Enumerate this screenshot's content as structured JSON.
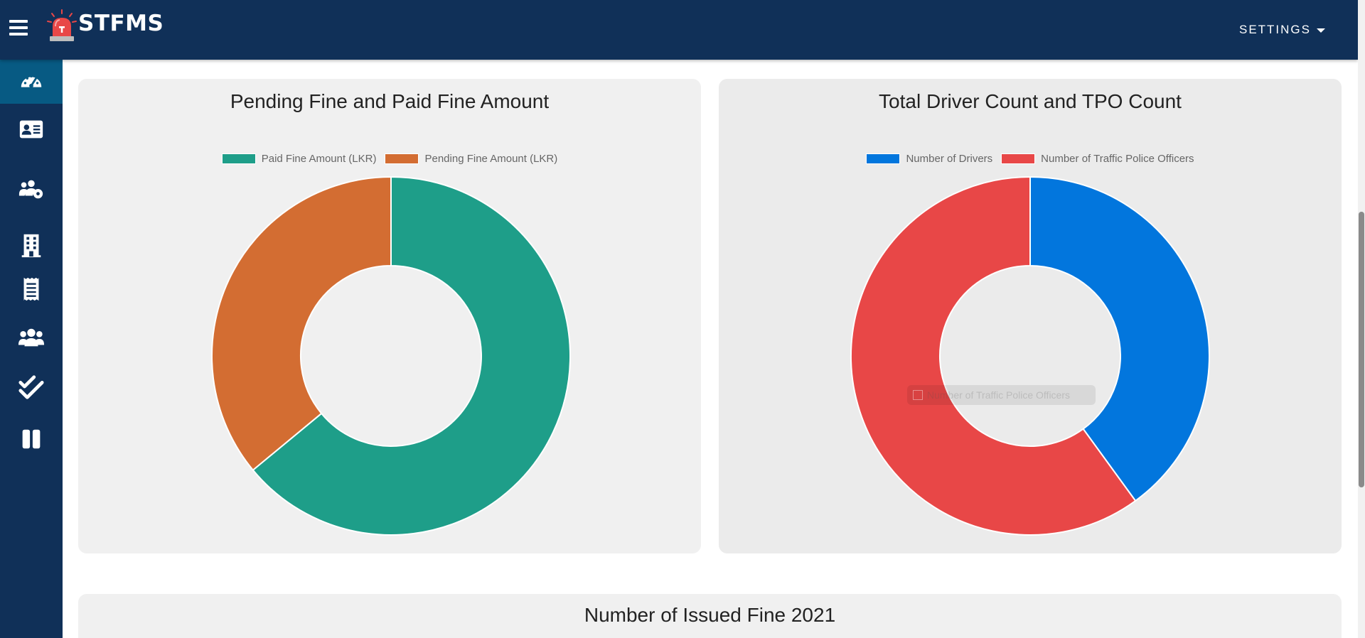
{
  "app": {
    "name": "STFMS"
  },
  "header": {
    "settings_label": "SETTINGS"
  },
  "sidebar": {
    "items": [
      {
        "icon": "dashboard-icon",
        "active": true
      },
      {
        "icon": "id-card-icon",
        "active": false
      },
      {
        "icon": "users-cog-icon",
        "active": false
      },
      {
        "icon": "building-icon",
        "active": false
      },
      {
        "icon": "receipt-icon",
        "active": false
      },
      {
        "icon": "users-icon",
        "active": false
      },
      {
        "icon": "check-double-icon",
        "active": false
      },
      {
        "icon": "pause-columns-icon",
        "active": false
      }
    ]
  },
  "colors": {
    "navbar": "#103058",
    "sidebar_active": "#075a83",
    "paid": "#1e9e89",
    "pending": "#d36d32",
    "drivers": "#0276dd",
    "officers": "#e84747"
  },
  "charts": {
    "fine_chart_title": "Pending Fine and Paid Fine Amount",
    "count_chart_title": "Total Driver Count and TPO Count",
    "issued_chart_title": "Number of Issued Fine 2021",
    "tooltip_text": "Number of Traffic Police Officers"
  },
  "chart_data": [
    {
      "type": "pie",
      "title": "Pending Fine and Paid Fine Amount",
      "labels": [
        "Paid Fine Amount (LKR)",
        "Pending Fine Amount (LKR)"
      ],
      "values": [
        64,
        36
      ],
      "colors": [
        "#1e9e89",
        "#d36d32"
      ],
      "legend": "top"
    },
    {
      "type": "pie",
      "title": "Total Driver Count and TPO Count",
      "labels": [
        "Number of Drivers",
        "Number of Traffic Police Officers"
      ],
      "values": [
        40,
        60
      ],
      "colors": [
        "#0276dd",
        "#e84747"
      ],
      "legend": "top"
    }
  ]
}
